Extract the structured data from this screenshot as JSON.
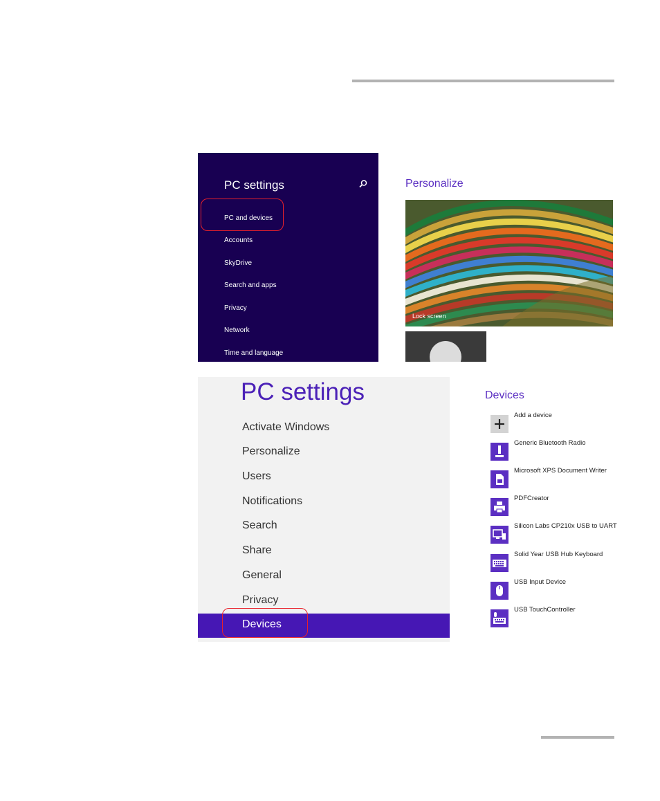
{
  "panel1": {
    "title": "PC settings",
    "nav": [
      "PC and devices",
      "Accounts",
      "SkyDrive",
      "Search and apps",
      "Privacy",
      "Network",
      "Time and language"
    ],
    "content_heading": "Personalize",
    "lock_screen_label": "Lock screen",
    "bg_color": "#180052"
  },
  "panel2": {
    "title": "PC settings",
    "nav": [
      "Activate Windows",
      "Personalize",
      "Users",
      "Notifications",
      "Search",
      "Share",
      "General",
      "Privacy"
    ],
    "selected_nav": "Devices",
    "content_heading": "Devices",
    "devices": [
      {
        "label": "Add a device",
        "icon": "plus-icon"
      },
      {
        "label": "Generic Bluetooth Radio",
        "icon": "bluetooth-radio-icon"
      },
      {
        "label": "Microsoft XPS Document Writer",
        "icon": "document-writer-icon"
      },
      {
        "label": "PDFCreator",
        "icon": "printer-icon"
      },
      {
        "label": "Silicon Labs CP210x USB to UART",
        "icon": "usb-uart-icon"
      },
      {
        "label": "Solid Year USB Hub Keyboard",
        "icon": "keyboard-icon"
      },
      {
        "label": "USB Input Device",
        "icon": "mouse-icon"
      },
      {
        "label": "USB TouchController",
        "icon": "touch-controller-icon"
      }
    ],
    "selected_color": "#4617b4"
  },
  "colors": {
    "accent": "#5b2fc2",
    "highlight_ring": "#e8202a"
  }
}
